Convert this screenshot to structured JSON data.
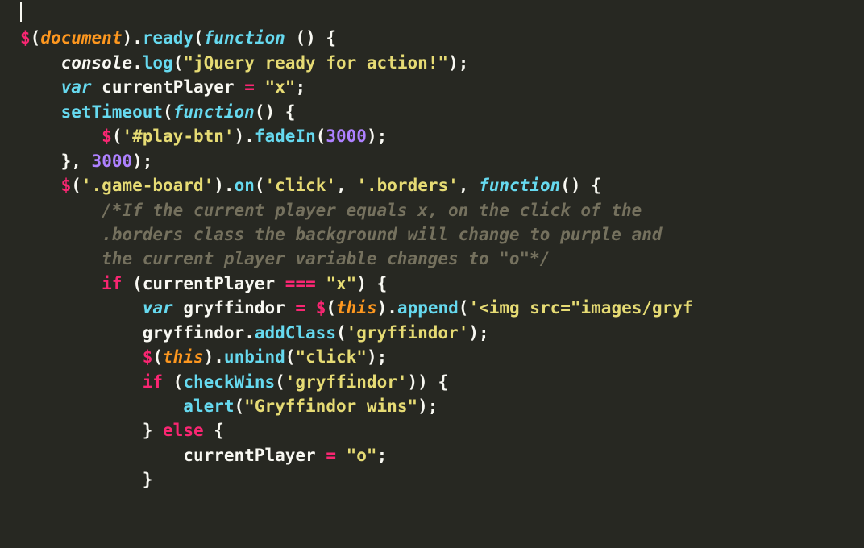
{
  "tokens": {
    "dollar": "$",
    "lp": "(",
    "rp": ")",
    "lb": "{",
    "rb": "}",
    "dot": ".",
    "comma": ",",
    "semi": ";",
    "eq": "=",
    "tripleeq": "===",
    "document": "document",
    "ready": "ready",
    "function_kw": "function",
    "console": "console",
    "log": "log",
    "s_jquery_ready": "\"jQuery ready for action!\"",
    "var_kw": "var",
    "currentPlayer": "currentPlayer",
    "s_x": "\"x\"",
    "setTimeout": "setTimeout",
    "s_playbtn": "'#play-btn'",
    "fadeIn": "fadeIn",
    "n3000a": "3000",
    "n3000b": "3000",
    "s_gameboard": "'.game-board'",
    "on": "on",
    "s_click": "'click'",
    "s_borders": "'.borders'",
    "comment1": "/*If the current player equals x, on the click of the ",
    "comment2": ".borders class the background will change to purple and ",
    "comment3": "the current player variable changes to \"o\"*/",
    "if_kw": "if",
    "gryffindor": "gryffindor",
    "this_kw": "this",
    "append": "append",
    "s_imgsrc": "'<img src=\"images/gryf",
    "addClass": "addClass",
    "s_gryffindor": "'gryffindor'",
    "unbind": "unbind",
    "s_click2": "\"click\"",
    "checkWins": "checkWins",
    "alert": "alert",
    "s_gryff_wins": "\"Gryffindor wins\"",
    "else_kw": "else",
    "s_o": "\"o\""
  }
}
